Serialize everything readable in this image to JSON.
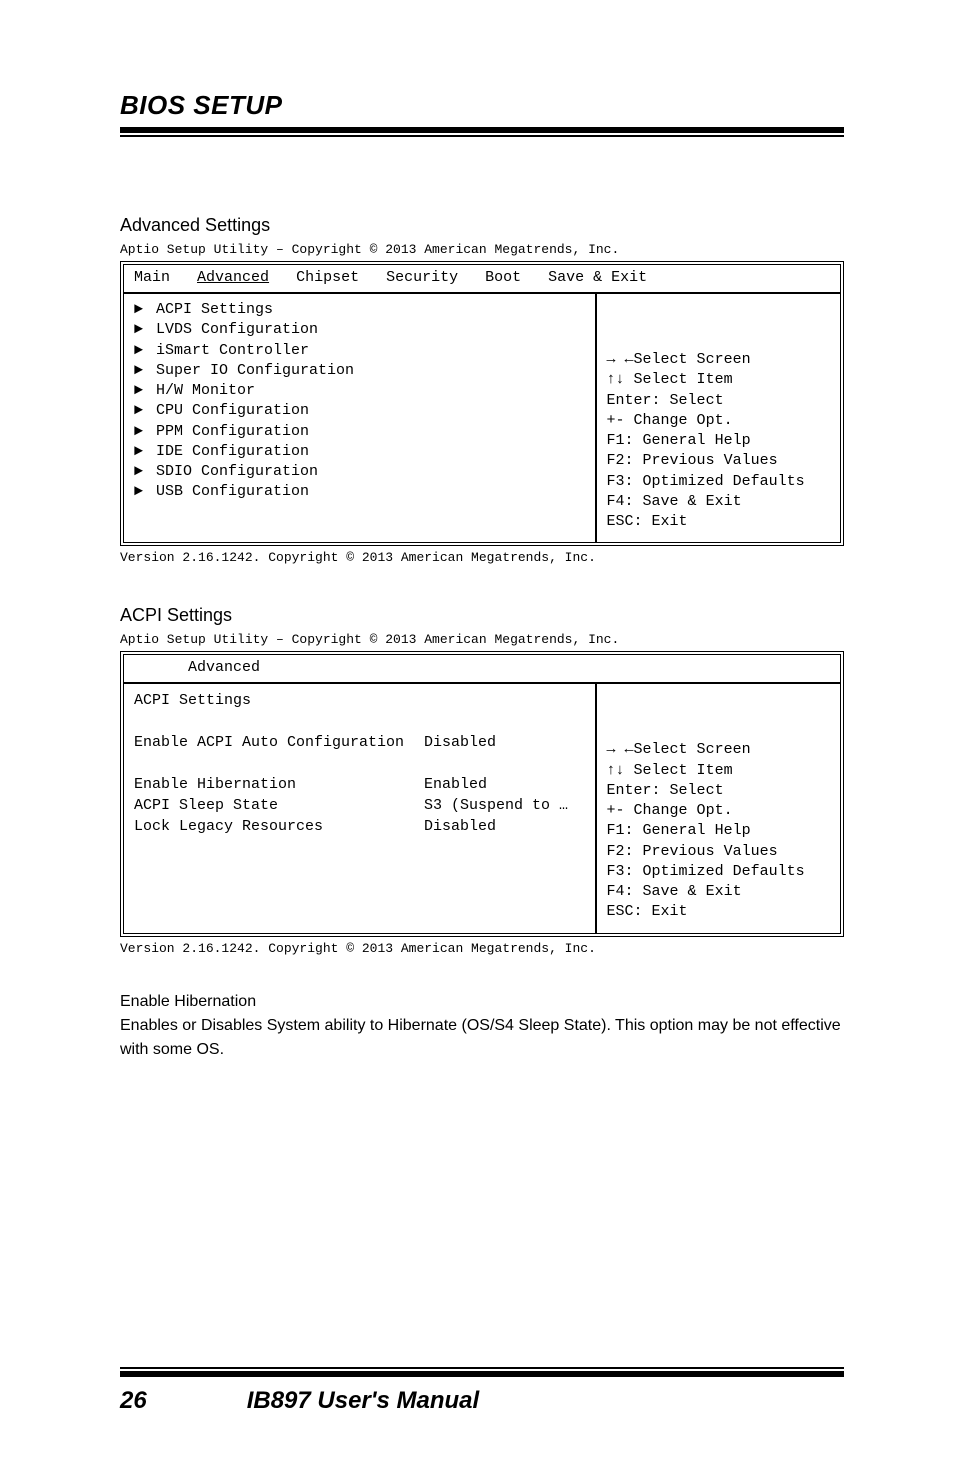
{
  "header": {
    "title": "BIOS SETUP"
  },
  "sections": [
    {
      "title": "Advanced Settings",
      "util_line": "Aptio Setup Utility – Copyright © 2013 American Megatrends, Inc.",
      "top_tabs": [
        "Main",
        "Advanced",
        "Chipset",
        "Security",
        "Boot",
        "Save & Exit"
      ],
      "menu": [
        "ACPI Settings",
        "LVDS Configuration",
        "iSmart Controller",
        "Super IO Configuration",
        "H/W Monitor",
        "CPU Configuration",
        "PPM Configuration",
        "IDE Configuration",
        "SDIO Configuration",
        "USB Configuration"
      ],
      "help": [
        "→ ←Select Screen",
        "↑↓ Select Item",
        "Enter: Select",
        "+-  Change Opt.",
        "F1: General Help",
        "F2: Previous Values",
        "F3: Optimized Defaults",
        "F4: Save & Exit",
        "ESC: Exit"
      ],
      "bottom": "Version 2.16.1242. Copyright © 2013 American Megatrends, Inc."
    },
    {
      "title": "ACPI Settings",
      "util_line": "Aptio Setup Utility – Copyright © 2013 American Megatrends, Inc.",
      "top_tabs_single": "Advanced",
      "kv": [
        {
          "k": "ACPI Settings",
          "v": ""
        },
        {
          "k": "",
          "v": ""
        },
        {
          "k": "Enable ACPI Auto Configuration",
          "v": "Disabled"
        },
        {
          "k": "",
          "v": ""
        },
        {
          "k": "Enable Hibernation",
          "v": "Enabled"
        },
        {
          "k": "ACPI Sleep State",
          "v": "S3 (Suspend to …"
        },
        {
          "k": "Lock Legacy Resources",
          "v": "Disabled"
        }
      ],
      "help": [
        "→ ←Select Screen",
        "↑↓ Select Item",
        "Enter: Select",
        "+-  Change Opt.",
        "F1: General Help",
        "F2: Previous Values",
        "F3: Optimized Defaults",
        "F4: Save & Exit",
        "ESC: Exit"
      ],
      "bottom": "Version 2.16.1242. Copyright © 2013 American Megatrends, Inc."
    }
  ],
  "note": {
    "heading": "Enable Hibernation",
    "body": "Enables or Disables System ability to Hibernate (OS/S4 Sleep State). This option may be not effective with some OS."
  },
  "footer": {
    "page": "26",
    "manual": "IB897 User's Manual"
  }
}
